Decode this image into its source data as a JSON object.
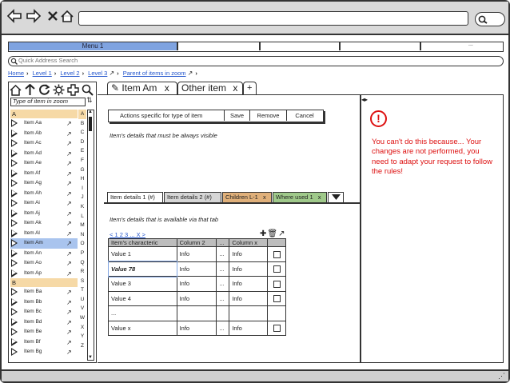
{
  "browser": {
    "icons": [
      "back-icon",
      "forward-icon",
      "close-icon",
      "home-icon",
      "search-icon"
    ]
  },
  "menubar": {
    "menu1": "Menu 1",
    "more": "..."
  },
  "quick_address": {
    "placeholder": "Quick Address Search"
  },
  "breadcrumb": {
    "home": "Home",
    "level1": "Level 1",
    "level2": "Level 2",
    "level3": "Level 3",
    "parent": "Parent of items in zoom"
  },
  "left_panel": {
    "type_placeholder": "Type of item in zoom",
    "group_a": "A",
    "group_b": "B",
    "items_a": [
      "Item Aa",
      "Item Ab",
      "Item Ac",
      "Item Ad",
      "Item Ae",
      "Item Af",
      "Item Ag",
      "Item Ah",
      "Item Ai",
      "Item Aj",
      "Item Ak",
      "Item Al",
      "Item Am",
      "Item An",
      "Item Ao",
      "Item Ap"
    ],
    "items_b": [
      "Item Ba",
      "Item Bb",
      "Item Bc",
      "Item Bd",
      "Item Be",
      "Item Bf",
      "Item Bg"
    ],
    "selected": "Item Am",
    "alphabet": [
      "A",
      "B",
      "C",
      "D",
      "E",
      "F",
      "G",
      "H",
      "I",
      "J",
      "K",
      "L",
      "M",
      "N",
      "O",
      "P",
      "Q",
      "R",
      "S",
      "T",
      "U",
      "V",
      "W",
      "X",
      "Y",
      "Z"
    ]
  },
  "tabs": {
    "tab1": "Item Am",
    "tab2": "Other item",
    "close": "x",
    "add": "+"
  },
  "actions": {
    "label": "Actions specific for type of item",
    "save": "Save",
    "remove": "Remove",
    "cancel": "Cancel"
  },
  "details_note": "Item's details that must be always visible",
  "subtabs": {
    "t1": "Item details 1 (#)",
    "t2": "Item details 2 (#)",
    "t3": "Children L-1",
    "t4": "Where used 1",
    "close": "x",
    "colors": {
      "t3": "#e0b07a",
      "t4": "#9fc98a",
      "active": "#ffffff",
      "inactive": "#d6d6d6"
    }
  },
  "tab_note": "Item's details that is available via that tab",
  "pager": "< 1 2 3 ... X >",
  "table": {
    "headers": [
      "Item's characteric",
      "Column 2",
      "...",
      "Column x"
    ],
    "rows": [
      [
        "Value 1",
        "Info",
        "...",
        "Info"
      ],
      [
        "Value 78",
        "Info",
        "...",
        "Info"
      ],
      [
        "Value 3",
        "Info",
        "...",
        "Info"
      ],
      [
        "Value 4",
        "Info",
        "...",
        "Info"
      ],
      [
        "...",
        "",
        "",
        ""
      ],
      [
        "Value x",
        "Info",
        "...",
        "Info"
      ]
    ]
  },
  "error": {
    "icon": "!",
    "message": "You can't do this because... Your changes are not performed, you need to adapt your request to follow the rules!"
  }
}
